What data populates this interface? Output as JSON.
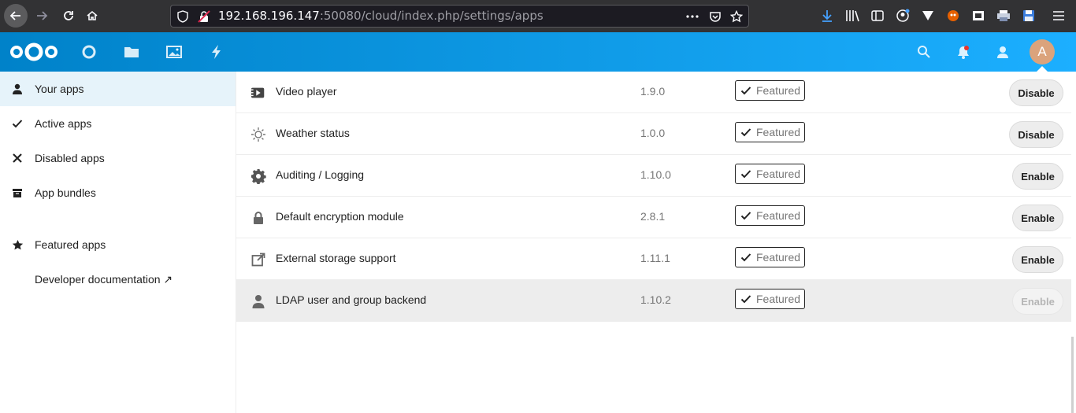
{
  "browser": {
    "url_host": "192.168.196.147",
    "url_path": ":50080/cloud/index.php/settings/apps"
  },
  "header": {
    "avatar_letter": "A",
    "accent_start": "#0082c9",
    "accent_end": "#1cafff"
  },
  "sidebar": {
    "items": [
      {
        "label": "Your apps",
        "icon": "user-icon"
      },
      {
        "label": "Active apps",
        "icon": "check-icon"
      },
      {
        "label": "Disabled apps",
        "icon": "close-icon"
      },
      {
        "label": "App bundles",
        "icon": "archive-icon"
      },
      {
        "label": "Featured apps",
        "icon": "star-icon"
      },
      {
        "label": "Developer documentation ↗",
        "icon": ""
      }
    ]
  },
  "apps": [
    {
      "name": "Video player",
      "version": "1.9.0",
      "badge": "Featured",
      "action": "Disable",
      "icon": "video-player-icon"
    },
    {
      "name": "Weather status",
      "version": "1.0.0",
      "badge": "Featured",
      "action": "Disable",
      "icon": "sun-icon"
    },
    {
      "name": "Auditing / Logging",
      "version": "1.10.0",
      "badge": "Featured",
      "action": "Enable",
      "icon": "gear-icon"
    },
    {
      "name": "Default encryption module",
      "version": "2.8.1",
      "badge": "Featured",
      "action": "Enable",
      "icon": "lock-icon"
    },
    {
      "name": "External storage support",
      "version": "1.11.1",
      "badge": "Featured",
      "action": "Enable",
      "icon": "external-link-icon"
    },
    {
      "name": "LDAP user and group backend",
      "version": "1.10.2",
      "badge": "Featured",
      "action": "Enable",
      "icon": "user-icon"
    }
  ]
}
